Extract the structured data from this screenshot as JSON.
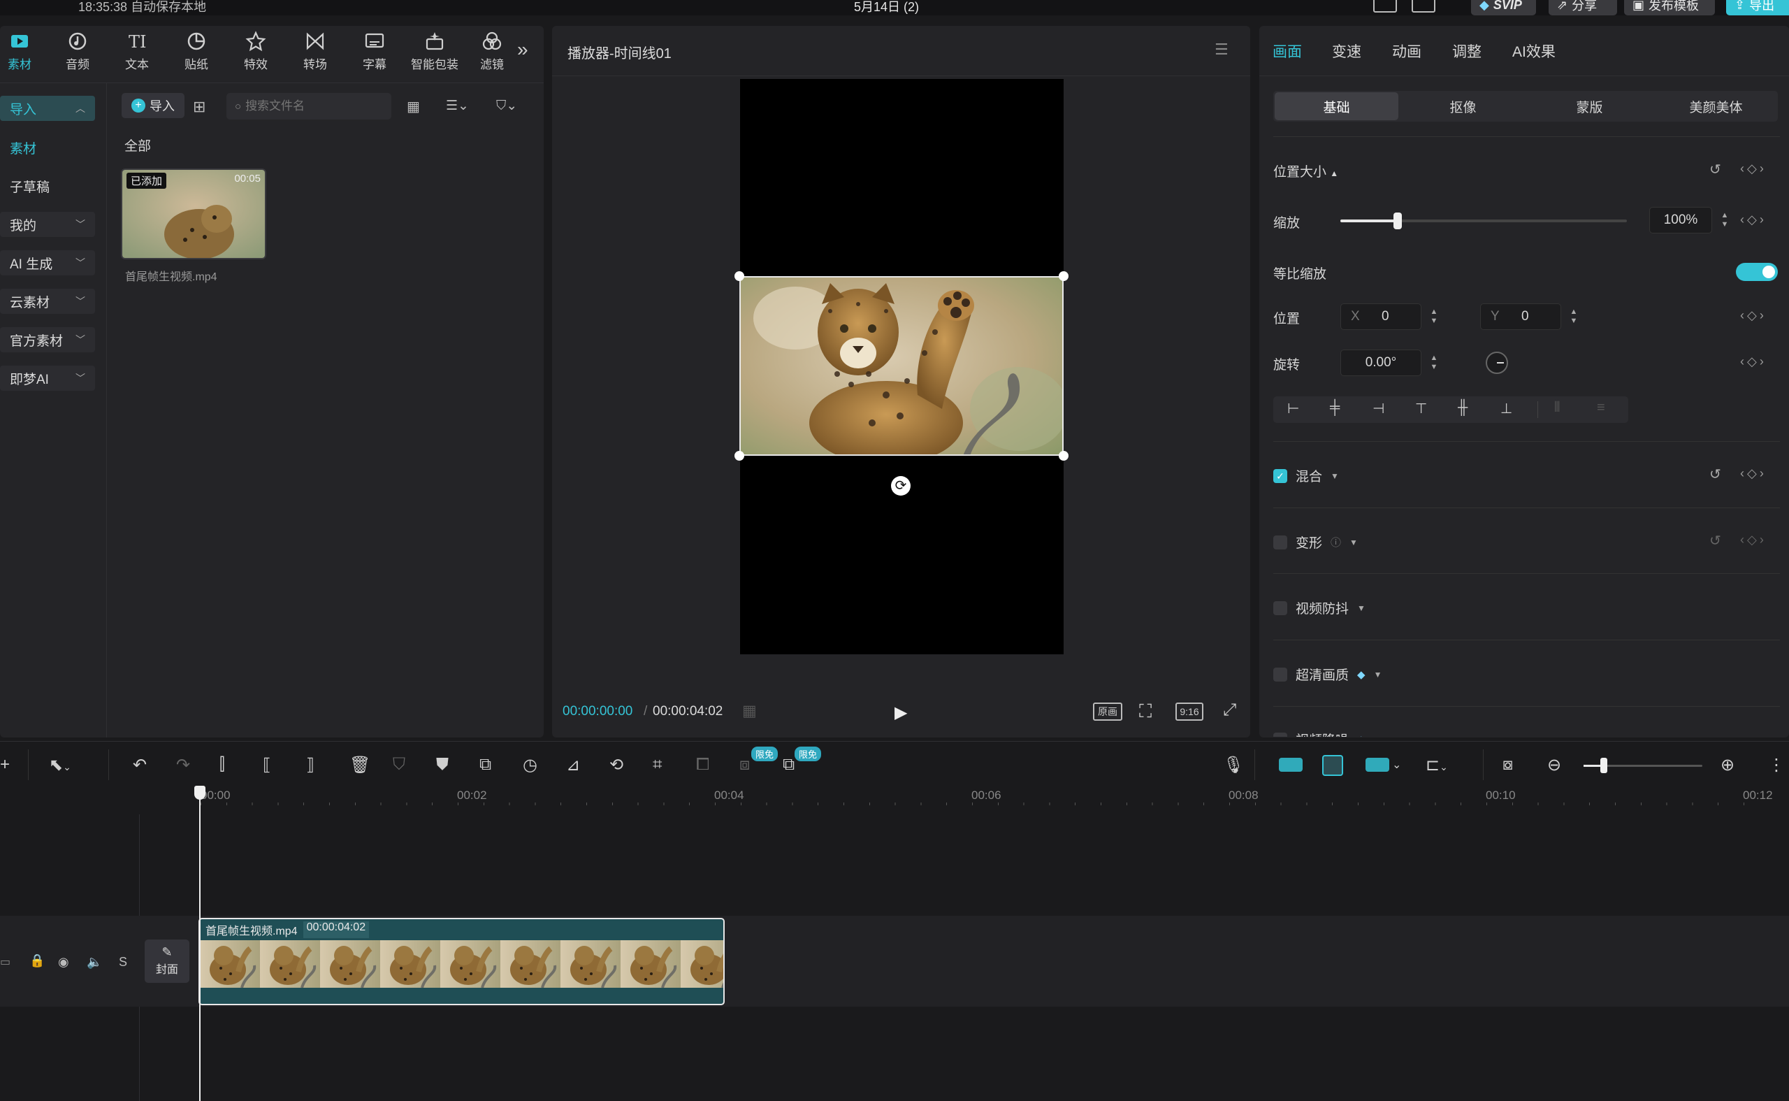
{
  "titlebar": {
    "autosave": "18:35:38 自动保存本地",
    "project": "5月14日 (2)",
    "svip": "SVIP",
    "share": "分享",
    "publish": "发布模板",
    "export": "导出"
  },
  "toolbar": {
    "items": [
      "素材",
      "音频",
      "文本",
      "贴纸",
      "特效",
      "转场",
      "字幕",
      "智能包装",
      "滤镜"
    ]
  },
  "sidebar": {
    "items": [
      "导入",
      "素材",
      "子草稿",
      "我的",
      "AI 生成",
      "云素材",
      "官方素材",
      "即梦AI"
    ]
  },
  "media": {
    "import_label": "导入",
    "search_placeholder": "搜索文件名",
    "category": "全部",
    "clip": {
      "badge": "已添加",
      "duration": "00:05",
      "filename": "首尾帧生视频.mp4"
    }
  },
  "player": {
    "title": "播放器-时间线01",
    "current_time": "00:00:00:00",
    "total_time": "00:00:04:02",
    "btn_original": "原画",
    "btn_ratio": "9:16"
  },
  "inspector": {
    "tabs": [
      "画面",
      "变速",
      "动画",
      "调整",
      "AI效果"
    ],
    "subtabs": [
      "基础",
      "抠像",
      "蒙版",
      "美颜美体"
    ],
    "position_size": "位置大小",
    "scale_label": "缩放",
    "scale_value": "100%",
    "scale_fraction": 0.2,
    "uniform_scale": "等比缩放",
    "position_label": "位置",
    "x_label": "X",
    "x_value": "0",
    "y_label": "Y",
    "y_value": "0",
    "rotate_label": "旋转",
    "rotate_value": "0.00°",
    "sections": [
      "混合",
      "变形",
      "视频防抖",
      "超清画质",
      "视频降噪"
    ]
  },
  "timeline": {
    "ticks": [
      "00:00",
      "00:02",
      "00:04",
      "00:06",
      "00:08",
      "00:10",
      "00:12"
    ],
    "badge_free": "限免",
    "cover_label": "封面",
    "track_s": "S",
    "clip_name": "首尾帧生视频.mp4",
    "clip_duration": "00:00:04:02"
  }
}
